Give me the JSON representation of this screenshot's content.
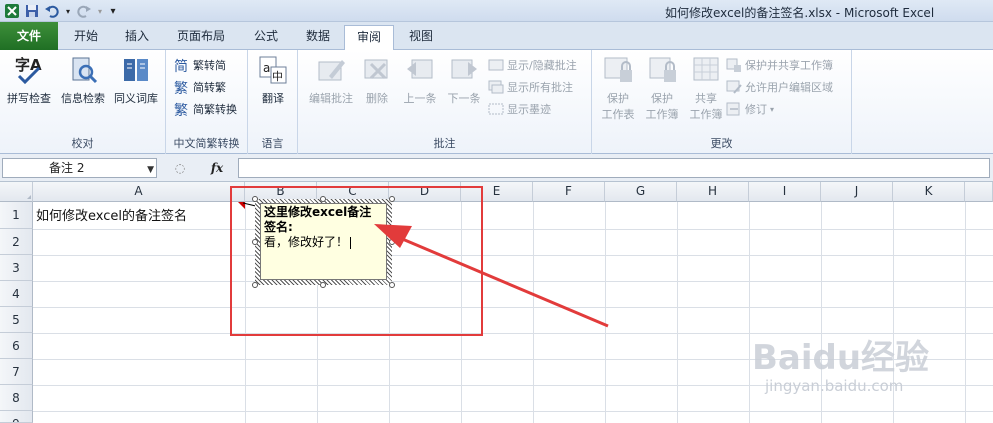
{
  "window": {
    "title": "如何修改excel的备注签名.xlsx - Microsoft Excel"
  },
  "tabs": [
    {
      "label": "文件"
    },
    {
      "label": "开始"
    },
    {
      "label": "插入"
    },
    {
      "label": "页面布局"
    },
    {
      "label": "公式"
    },
    {
      "label": "数据"
    },
    {
      "label": "审阅"
    },
    {
      "label": "视图"
    }
  ],
  "ribbon": {
    "groups": {
      "proofing": {
        "label": "校对",
        "spelling": "拼写检查",
        "research": "信息检索",
        "thesaurus": "同义词库"
      },
      "chinese": {
        "label": "中文简繁转换",
        "to_simplified": "繁转简",
        "to_traditional": "简转繁",
        "convert": "简繁转换"
      },
      "language": {
        "label": "语言",
        "translate": "翻译"
      },
      "comments": {
        "label": "批注",
        "edit": "编辑批注",
        "delete": "删除",
        "prev": "上一条",
        "next": "下一条",
        "show_hide": "显示/隐藏批注",
        "show_all": "显示所有批注",
        "show_ink": "显示墨迹"
      },
      "changes": {
        "label": "更改",
        "protect_sheet_1": "保护",
        "protect_sheet_2": "工作表",
        "protect_wb_1": "保护",
        "protect_wb_2": "工作簿",
        "share_wb_1": "共享",
        "share_wb_2": "工作簿",
        "protect_share": "保护并共享工作簿",
        "allow_edit": "允许用户编辑区域",
        "track": "修订"
      }
    }
  },
  "formula_bar": {
    "name_box": "备注 2",
    "fx": "fx",
    "formula": ""
  },
  "columns": [
    "A",
    "B",
    "C",
    "D",
    "E",
    "F",
    "G",
    "H",
    "I",
    "J",
    "K"
  ],
  "rows": [
    "1",
    "2",
    "3",
    "4",
    "5",
    "6",
    "7",
    "8",
    "9"
  ],
  "cells": {
    "A1": "如何修改excel的备注签名"
  },
  "comment": {
    "author": "这里修改excel备注签名:",
    "text": "看，修改好了！"
  },
  "watermark": {
    "brand": "Baidu经验",
    "url": "jingyan.baidu.com"
  },
  "colors": {
    "file_tab": "#2a7d2e",
    "annotation": "#e23b3b",
    "comment_bg": "#ffffe1"
  }
}
